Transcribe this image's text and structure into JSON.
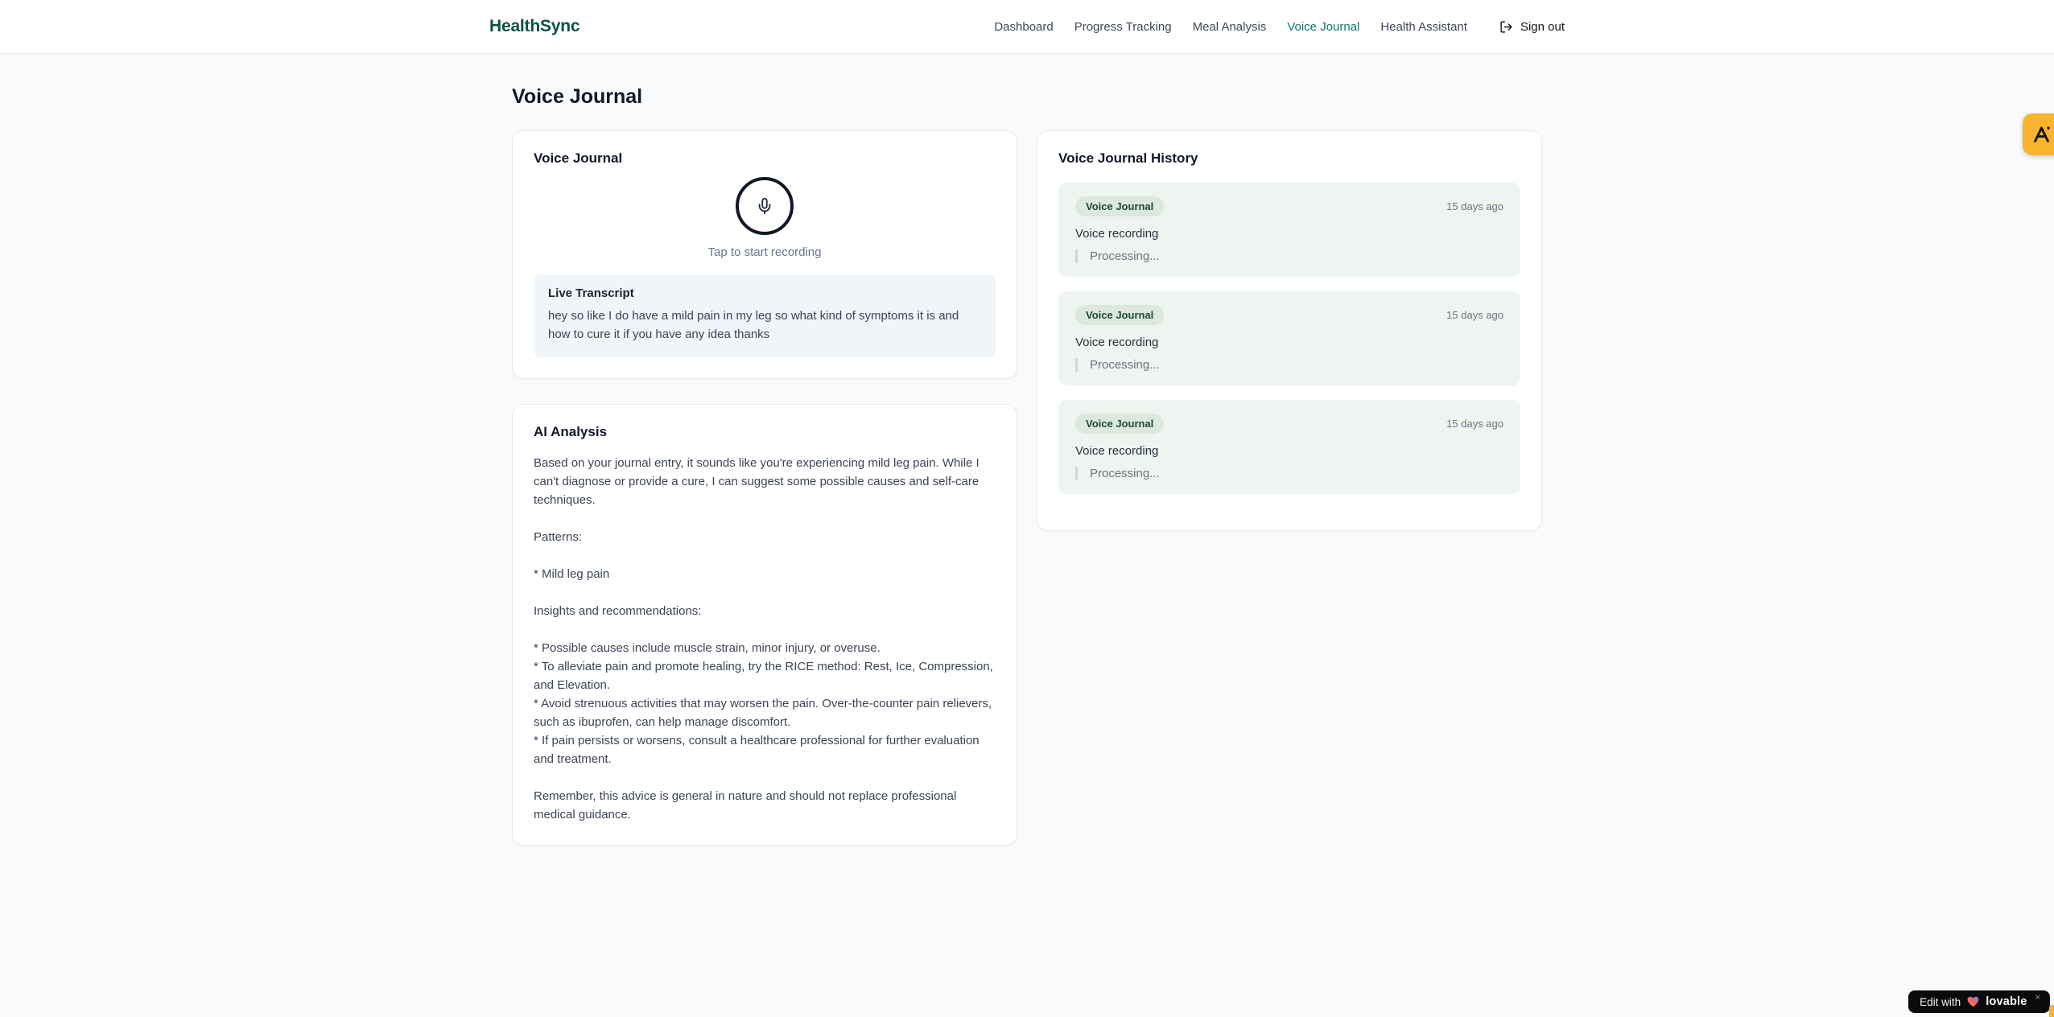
{
  "header": {
    "logo": "HealthSync",
    "nav": [
      {
        "label": "Dashboard",
        "active": false
      },
      {
        "label": "Progress Tracking",
        "active": false
      },
      {
        "label": "Meal Analysis",
        "active": false
      },
      {
        "label": "Voice Journal",
        "active": true
      },
      {
        "label": "Health Assistant",
        "active": false
      }
    ],
    "signout_label": "Sign out"
  },
  "page": {
    "title": "Voice Journal"
  },
  "recorder": {
    "title": "Voice Journal",
    "hint": "Tap to start recording",
    "transcript_title": "Live Transcript",
    "transcript_text": "hey so like I do have a mild pain in my leg so what kind of symptoms it is and how to cure it if you have any idea thanks"
  },
  "analysis": {
    "title": "AI Analysis",
    "body": "Based on your journal entry, it sounds like you're experiencing mild leg pain. While I can't diagnose or provide a cure, I can suggest some possible causes and self-care techniques.\n\nPatterns:\n\n* Mild leg pain\n\nInsights and recommendations:\n\n* Possible causes include muscle strain, minor injury, or overuse.\n* To alleviate pain and promote healing, try the RICE method: Rest, Ice, Compression, and Elevation.\n* Avoid strenuous activities that may worsen the pain. Over-the-counter pain relievers, such as ibuprofen, can help manage discomfort.\n* If pain persists or worsens, consult a healthcare professional for further evaluation and treatment.\n\nRemember, this advice is general in nature and should not replace professional medical guidance."
  },
  "history": {
    "title": "Voice Journal History",
    "items": [
      {
        "badge": "Voice Journal",
        "time": "15 days ago",
        "label": "Voice recording",
        "status": "Processing..."
      },
      {
        "badge": "Voice Journal",
        "time": "15 days ago",
        "label": "Voice recording",
        "status": "Processing..."
      },
      {
        "badge": "Voice Journal",
        "time": "15 days ago",
        "label": "Voice recording",
        "status": "Processing..."
      }
    ]
  },
  "badges": {
    "edit_with": "Edit with",
    "brand": "lovable",
    "close": "×"
  },
  "colors": {
    "brand_logo": "#0b5244",
    "nav_active": "#0f766e",
    "history_item_bg": "#eef5f0",
    "badge_pill_bg": "#dbe8dd",
    "amber_widget": "#f9b42e"
  }
}
